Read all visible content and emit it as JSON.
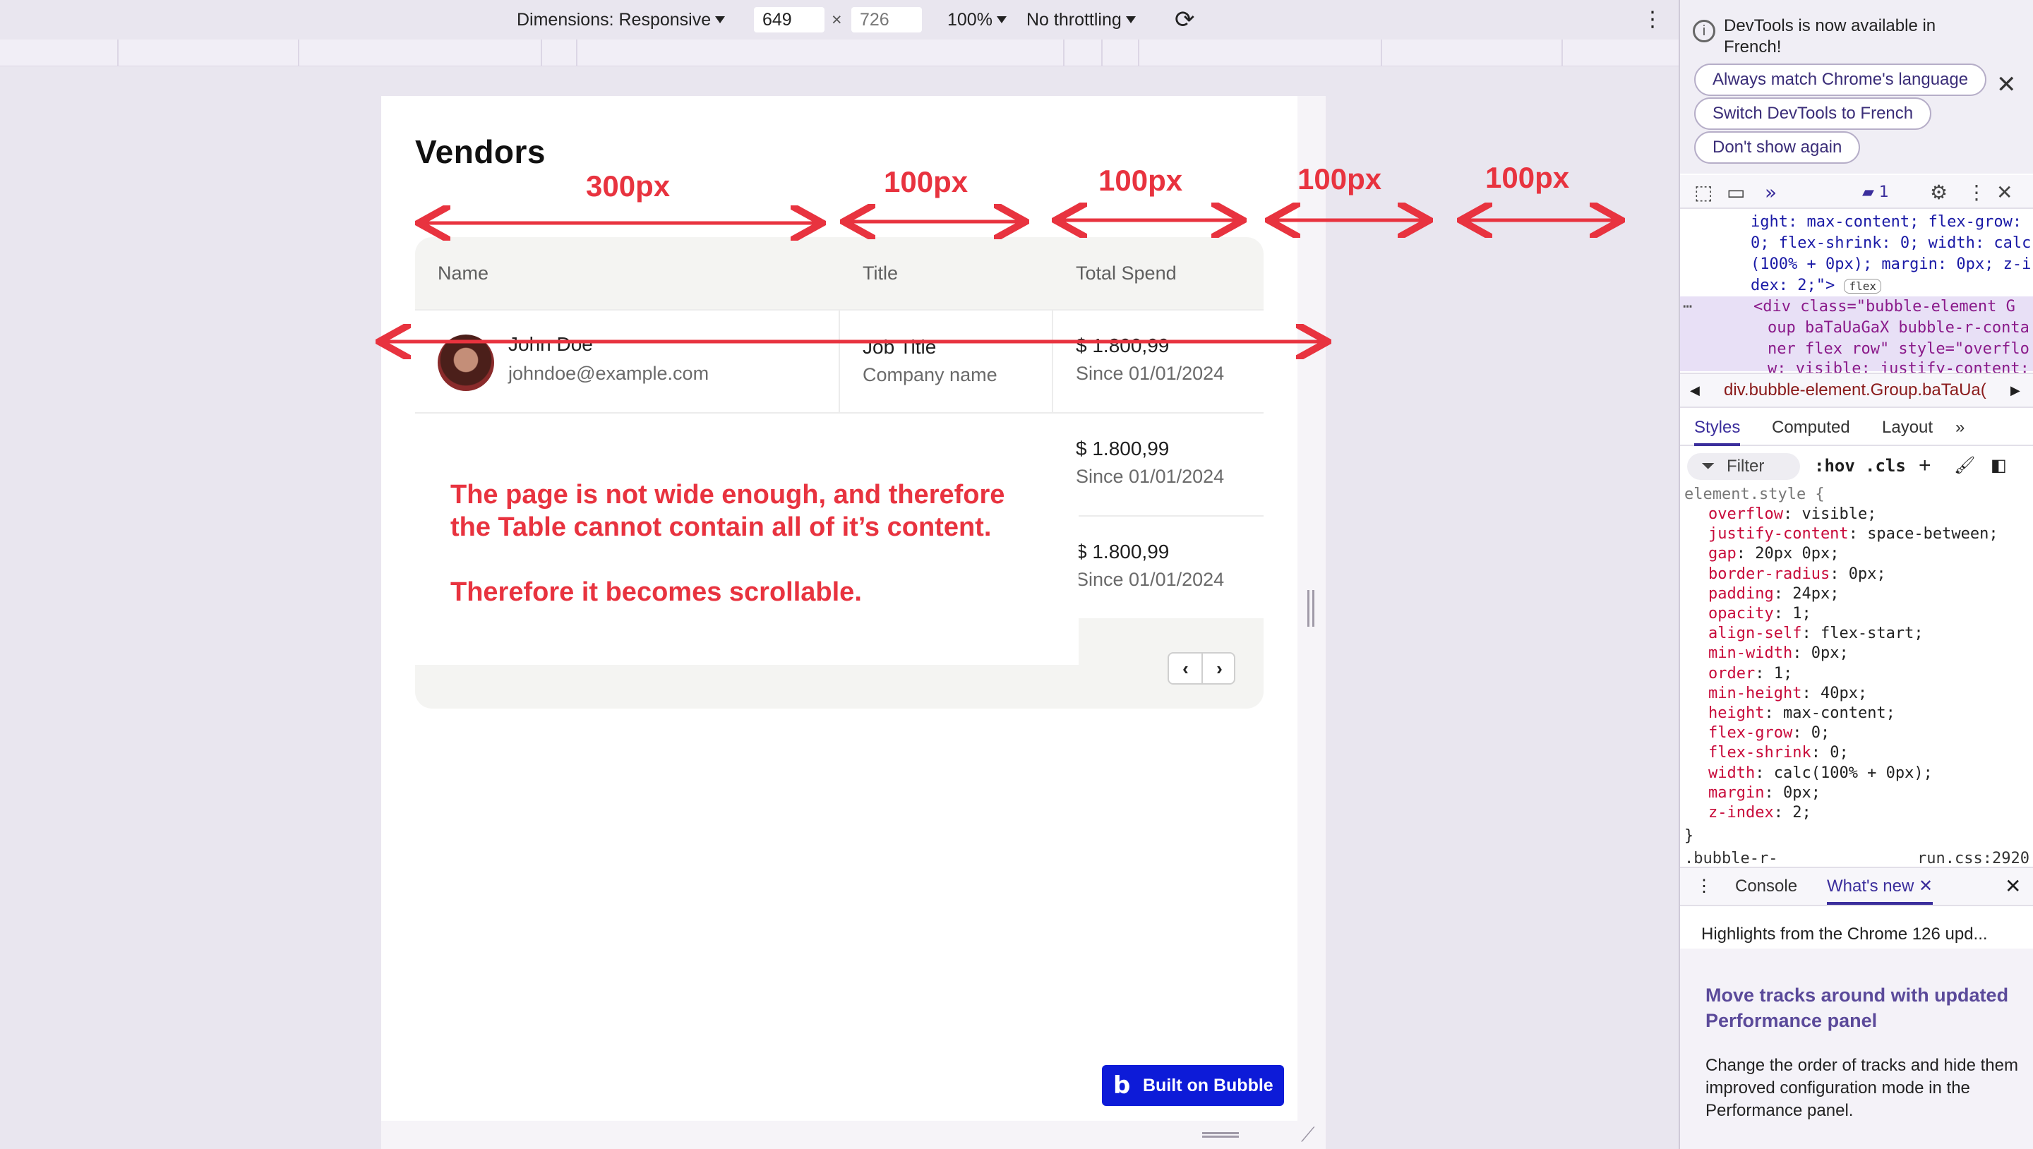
{
  "device_toolbar": {
    "dimensions_label": "Dimensions: Responsive",
    "width_value": "649",
    "times": "×",
    "height_value": "726",
    "zoom": "100%",
    "throttling": "No throttling"
  },
  "page": {
    "title": "Vendors",
    "table": {
      "columns": [
        "Name",
        "Title",
        "Total Spend"
      ],
      "rows": [
        {
          "name": "John Doe",
          "email": "johndoe@example.com",
          "job_title": "Job Title",
          "company": "Company name",
          "spend": "$ 1.800,99",
          "since": "Since 01/01/2024"
        },
        {
          "spend": "$ 1.800,99",
          "since": "Since 01/01/2024"
        },
        {
          "spend": "$ 1.800,99",
          "since": "Since 01/01/2024"
        }
      ],
      "pager_prev": "‹",
      "pager_next": "›"
    },
    "badge": "Built on Bubble"
  },
  "annotations": {
    "widths": [
      "300px",
      "100px",
      "100px",
      "100px",
      "100px"
    ],
    "message_line1": "The page is not wide enough, and therefore",
    "message_line2": "the Table cannot contain all of it’s content.",
    "message_line3": "Therefore it becomes scrollable.",
    "color": "#e8333f"
  },
  "devtools": {
    "notice": "DevTools is now available in French!",
    "chip_match": "Always match Chrome's language",
    "chip_switch": "Switch DevTools to French",
    "chip_dont_show": "Don't show again",
    "issues_count": "1",
    "elements_lines": [
      "ight: max-content; flex-grow:",
      "0; flex-shrink: 0; width: calc",
      "(100% + 0px); margin: 0px; z-i",
      "dex: 2;\">",
      "<div class=\"bubble-element G",
      "oup baTaUaGaX bubble-r-conta",
      "ner flex row\" style=\"overflo",
      "w: visible; justify-content:"
    ],
    "flex_badge": "flex",
    "breadcrumb": "div.bubble-element.Group.baTaUa(",
    "subtabs": [
      "Styles",
      "Computed",
      "Layout"
    ],
    "filter_placeholder": "Filter",
    "hov": ":hov",
    "cls": ".cls",
    "style_selector": "element.style {",
    "style_props": [
      {
        "p": "overflow",
        "v": "visible;"
      },
      {
        "p": "justify-content",
        "v": "space-between;"
      },
      {
        "p": "gap",
        "v": "20px 0px;"
      },
      {
        "p": "border-radius",
        "v": "0px;"
      },
      {
        "p": "padding",
        "v": "24px;"
      },
      {
        "p": "opacity",
        "v": "1;"
      },
      {
        "p": "align-self",
        "v": "flex-start;"
      },
      {
        "p": "min-width",
        "v": "0px;"
      },
      {
        "p": "order",
        "v": "1;"
      },
      {
        "p": "min-height",
        "v": "40px;"
      },
      {
        "p": "height",
        "v": "max-content;"
      },
      {
        "p": "flex-grow",
        "v": "0;"
      },
      {
        "p": "flex-shrink",
        "v": "0;"
      },
      {
        "p": "width",
        "v": "calc(100% + 0px);"
      },
      {
        "p": "margin",
        "v": "0px;"
      },
      {
        "p": "z-index",
        "v": "2;"
      }
    ],
    "close_brace": "}",
    "next_rule": ".bubble-r-",
    "next_rule_src": "run.css:2920",
    "drawer_console": "Console",
    "drawer_whatsnew": "What's new",
    "highlights": "Highlights from the Chrome 126 upd...",
    "whatsnew_title": "Move tracks around with updated Performance panel",
    "whatsnew_body": "Change the order of tracks and hide them improved configuration mode in the Performance panel."
  }
}
